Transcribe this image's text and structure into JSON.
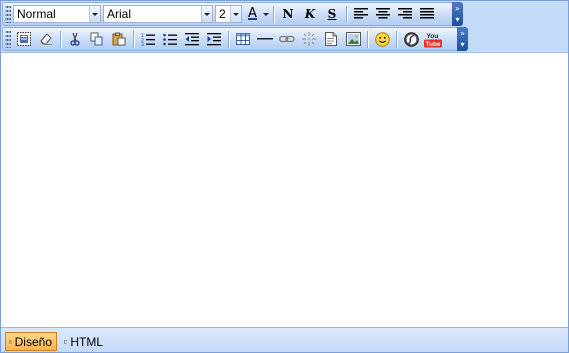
{
  "toolbar1": {
    "format_value": "Normal",
    "font_value": "Arial",
    "size_value": "2",
    "font_color_letter": "A",
    "bold_letter": "N",
    "italic_letter": "K",
    "underline_letter": "S"
  },
  "toolbar2": {
    "youtube_label_top": "You",
    "youtube_label_bottom": "Tube"
  },
  "modes": {
    "design": "Diseño",
    "html": "HTML"
  },
  "colors": {
    "toolbar_bg": "#c3daf9",
    "active_tab": "#ffb54d",
    "youtube_red": "#e52d27"
  }
}
